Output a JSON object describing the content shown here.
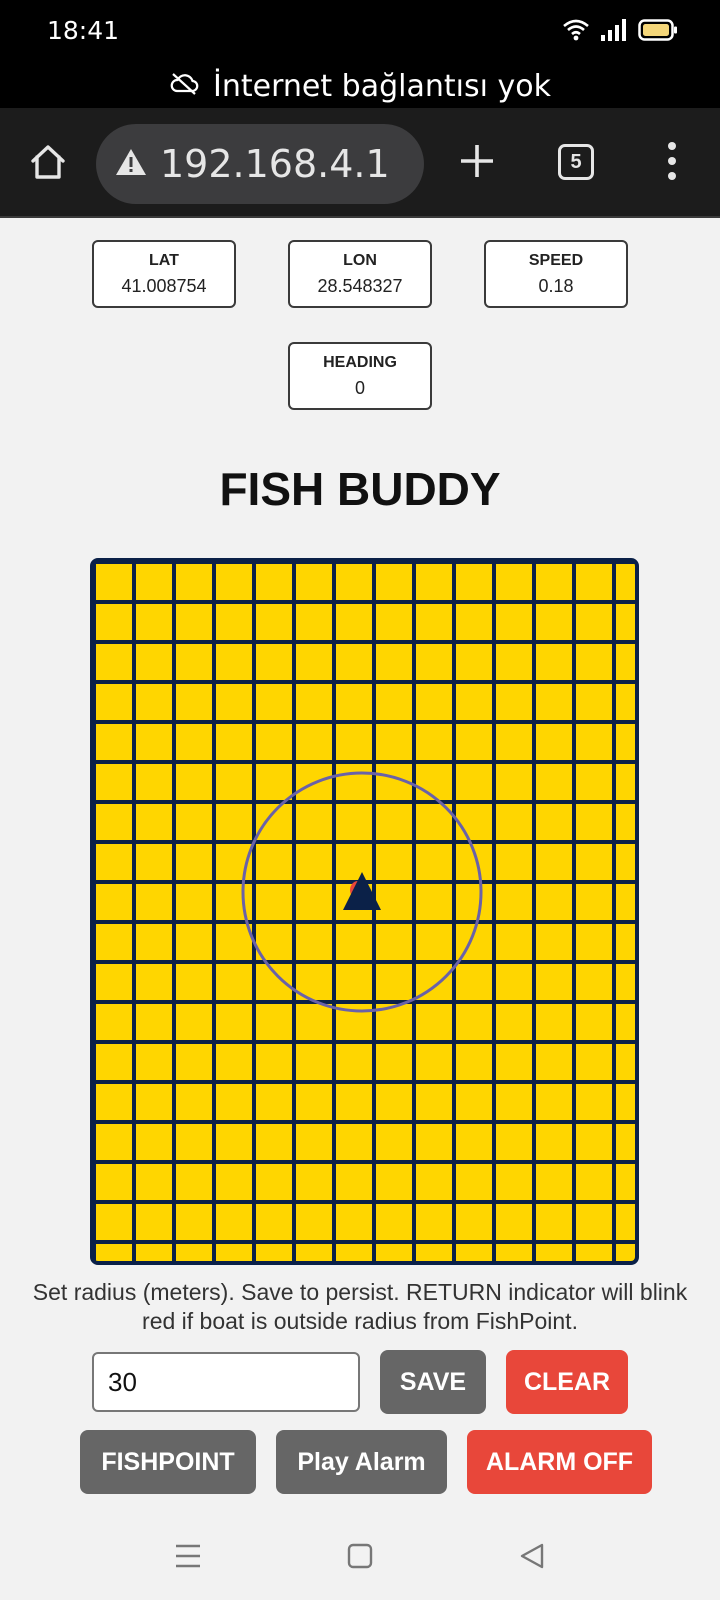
{
  "status": {
    "time": "18:41"
  },
  "offline_banner": {
    "text": "İnternet bağlantısı yok"
  },
  "browser": {
    "url": "192.168.4.1",
    "tab_count": "5"
  },
  "telemetry": {
    "lat": {
      "label": "LAT",
      "value": "41.008754"
    },
    "lon": {
      "label": "LON",
      "value": "28.548327"
    },
    "speed": {
      "label": "SPEED",
      "value": "0.18"
    },
    "heading": {
      "label": "HEADING",
      "value": "0"
    }
  },
  "title": "FISH BUDDY",
  "map": {
    "grid_color": "#0b2148",
    "fill_color": "#ffd600",
    "boat_color": "#0b2148",
    "radius_circle_color": "#6a62a8",
    "fishpoint_color": "#e8473a"
  },
  "instructions": "Set radius (meters). Save to persist. RETURN indicator will blink red if boat is outside radius from FishPoint.",
  "controls": {
    "radius_value": "30",
    "save_label": "SAVE",
    "clear_label": "CLEAR",
    "fishpoint_label": "FISHPOINT",
    "play_alarm_label": "Play Alarm",
    "alarm_off_label": "ALARM OFF"
  }
}
